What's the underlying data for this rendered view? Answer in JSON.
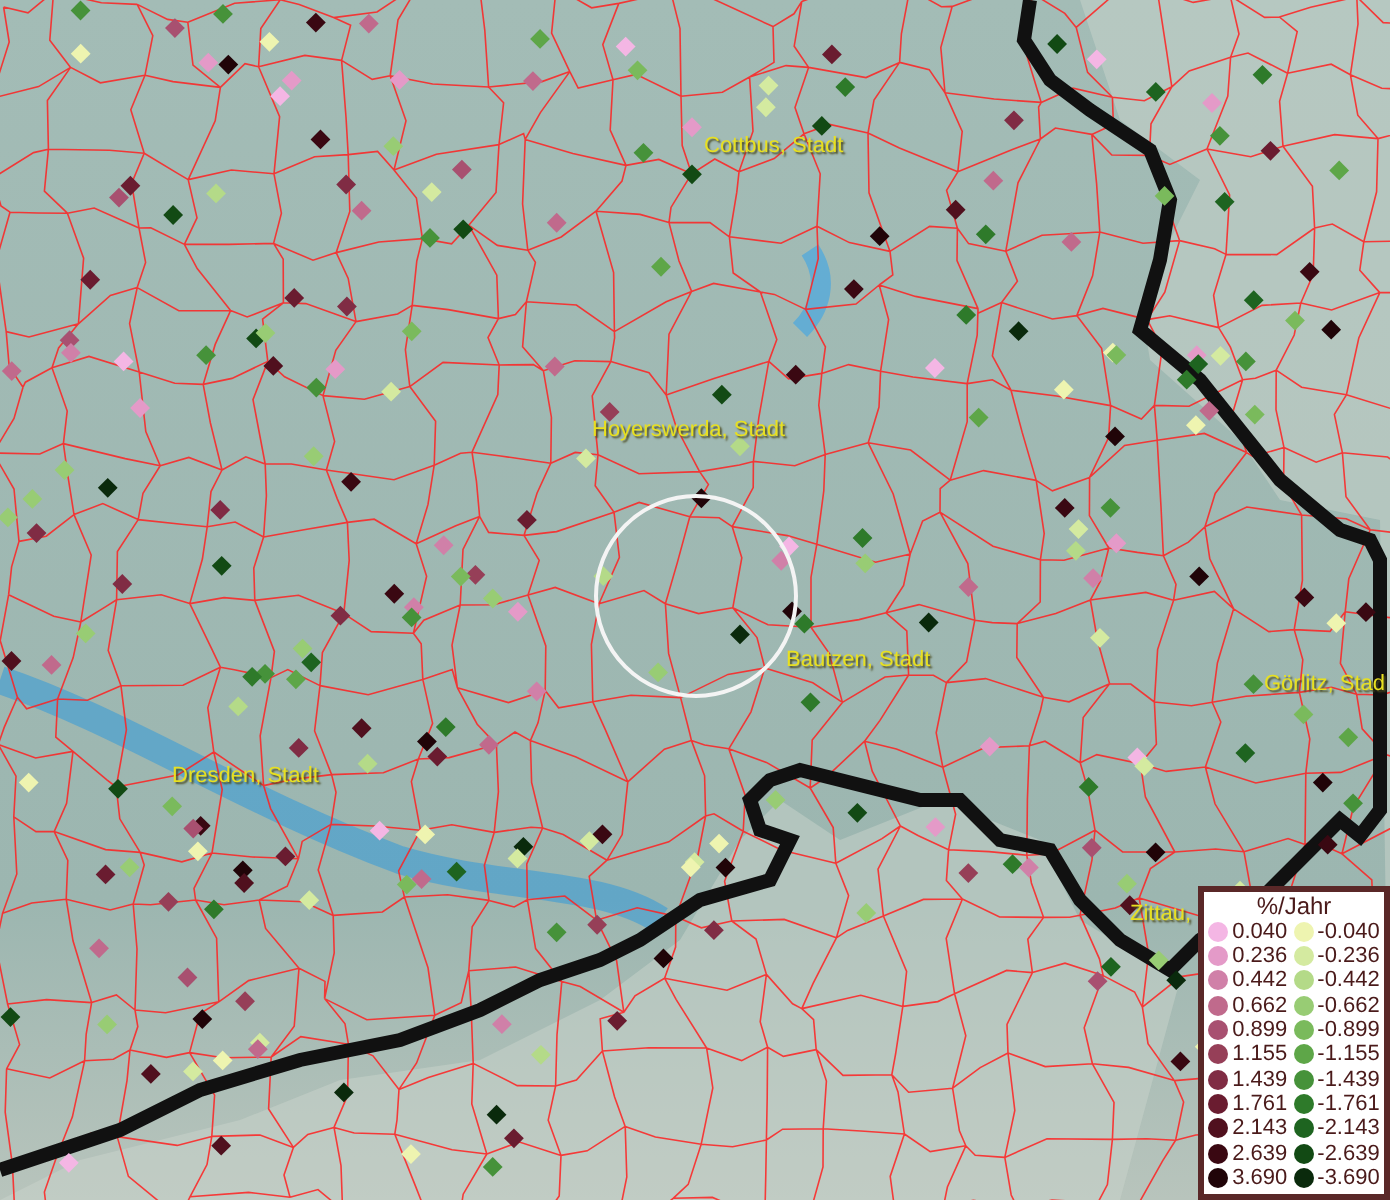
{
  "map": {
    "places": [
      {
        "label": "Cottbus, Stadt"
      },
      {
        "label": "Hoyerswerda, Stadt"
      },
      {
        "label": "Bautzen, Stadt"
      },
      {
        "label": "Dresden, Stadt"
      },
      {
        "label": "Görlitz, Stad"
      },
      {
        "label": "Zittau,"
      }
    ]
  },
  "legend": {
    "title": "%/Jahr",
    "columns": [
      {
        "entries": [
          {
            "label": "0.040",
            "color": "#f4b6e4"
          },
          {
            "label": "0.236",
            "color": "#e49ac8"
          },
          {
            "label": "0.442",
            "color": "#d080a8"
          },
          {
            "label": "0.662",
            "color": "#c06a8c"
          },
          {
            "label": "0.899",
            "color": "#a85070"
          },
          {
            "label": "1.155",
            "color": "#963f58"
          },
          {
            "label": "1.439",
            "color": "#802c44"
          },
          {
            "label": "1.761",
            "color": "#6a1c30"
          },
          {
            "label": "2.143",
            "color": "#50101e"
          },
          {
            "label": "2.639",
            "color": "#3a0812"
          },
          {
            "label": "3.690",
            "color": "#200408"
          }
        ]
      },
      {
        "entries": [
          {
            "label": "-0.040",
            "color": "#eef4b0"
          },
          {
            "label": "-0.236",
            "color": "#d4eaa0"
          },
          {
            "label": "-0.442",
            "color": "#b4da88"
          },
          {
            "label": "-0.662",
            "color": "#98cc74"
          },
          {
            "label": "-0.899",
            "color": "#7aba5c"
          },
          {
            "label": "-1.155",
            "color": "#5ea648"
          },
          {
            "label": "-1.439",
            "color": "#46923a"
          },
          {
            "label": "-1.761",
            "color": "#2e7a2a"
          },
          {
            "label": "-2.143",
            "color": "#1e6420"
          },
          {
            "label": "-2.639",
            "color": "#124a14"
          },
          {
            "label": "-3.690",
            "color": "#0a2a0c"
          }
        ]
      }
    ]
  }
}
